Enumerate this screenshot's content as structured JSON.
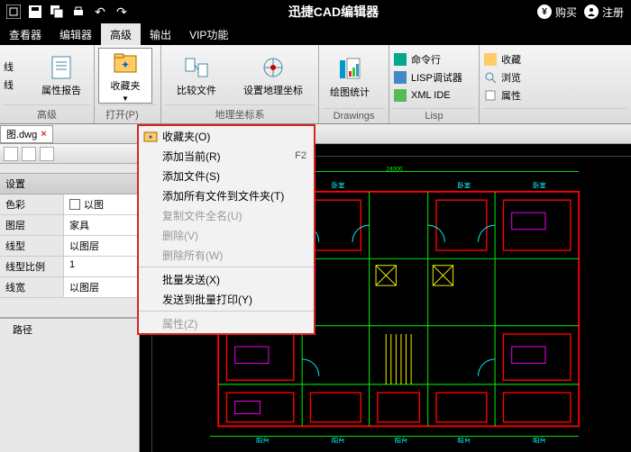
{
  "titlebar": {
    "title": "迅捷CAD编辑器",
    "buy": "购买",
    "register": "注册"
  },
  "menubar": {
    "items": [
      {
        "label": "查看器"
      },
      {
        "label": "编辑器"
      },
      {
        "label": "高级",
        "active": true
      },
      {
        "label": "输出"
      },
      {
        "label": "VIP功能"
      }
    ]
  },
  "ribbon": {
    "groups": [
      {
        "label": "高级",
        "items": [
          {
            "label": "线"
          },
          {
            "label": "线"
          }
        ],
        "big": {
          "label": "属性报告"
        }
      },
      {
        "label": "",
        "big": {
          "label": "收藏夹",
          "open": true
        }
      },
      {
        "label": "地理坐标系",
        "items": [
          {
            "label": "比较文件"
          },
          {
            "label": "设置地理坐标"
          }
        ]
      },
      {
        "label": "Drawings",
        "big": {
          "label": "绘图统计"
        }
      },
      {
        "label": "Lisp",
        "small": [
          {
            "label": "命令行",
            "color": "#0a8"
          },
          {
            "label": "LISP调试器",
            "color": "#48c"
          },
          {
            "label": "XML IDE",
            "color": "#5b5"
          }
        ]
      },
      {
        "label": "",
        "small": [
          {
            "label": "收藏"
          },
          {
            "label": "浏览"
          },
          {
            "label": "属性"
          }
        ]
      }
    ]
  },
  "openLabel": "打开(P)",
  "doctab": "图.dwg",
  "dropdown": {
    "items": [
      {
        "label": "收藏夹(O)",
        "icon": true
      },
      {
        "label": "添加当前(R)",
        "shortcut": "F2"
      },
      {
        "label": "添加文件(S)"
      },
      {
        "label": "添加所有文件到文件夹(T)"
      },
      {
        "label": "复制文件全名(U)",
        "disabled": true
      },
      {
        "label": "删除(V)",
        "disabled": true
      },
      {
        "label": "删除所有(W)",
        "disabled": true
      },
      {
        "sep": true
      },
      {
        "label": "批量发送(X)"
      },
      {
        "label": "发送到批量打印(Y)"
      },
      {
        "sep": true
      },
      {
        "label": "属性(Z)",
        "disabled": true
      }
    ]
  },
  "leftpanel": {
    "section": "设置",
    "rows": [
      {
        "k": "色彩",
        "v": "以图",
        "checkbox": true
      },
      {
        "k": "图层",
        "v": "家具"
      },
      {
        "k": "线型",
        "v": "以图层"
      },
      {
        "k": "线型比例",
        "v": "1"
      },
      {
        "k": "线宽",
        "v": "以图层"
      }
    ],
    "footer": [
      {
        "label": ""
      },
      {
        "label": "路径"
      }
    ]
  }
}
